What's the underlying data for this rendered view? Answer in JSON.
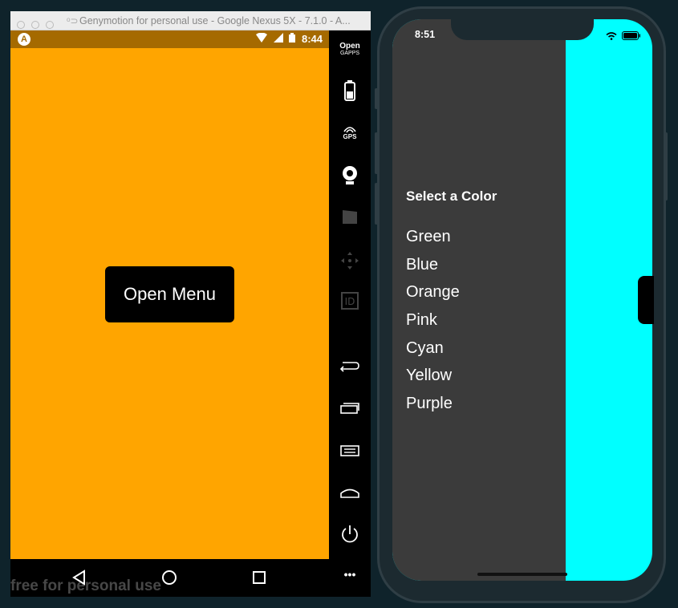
{
  "genymotion": {
    "window_title": "Genymotion for personal use - Google Nexus 5X - 7.1.0 - A...",
    "status_time": "8:44",
    "app_icon_letter": "A",
    "open_menu_label": "Open Menu",
    "watermark": "free for personal use",
    "sidebar": {
      "opengapps_line1": "Open",
      "opengapps_line2": "GAPPS",
      "gps_label": "GPS",
      "id_label": "ID",
      "more_label": "•••"
    }
  },
  "iphone": {
    "time": "8:51",
    "drawer_title": "Select a Color",
    "colors": [
      "Green",
      "Blue",
      "Orange",
      "Pink",
      "Cyan",
      "Yellow",
      "Purple"
    ]
  },
  "theme": {
    "app_background": "#ffa500",
    "drawer_background": "#3b3b3b",
    "content_background": "#00ffff",
    "status_bar": "#a56a00",
    "desktop_background": "#0f232b"
  },
  "icons": [
    "battery-icon",
    "gps-icon",
    "webcam-icon",
    "clapper-icon",
    "move-icon",
    "id-icon",
    "back-icon",
    "recents-icon",
    "menu-icon",
    "home-icon",
    "power-icon",
    "more-icon",
    "wifi-icon",
    "signal-icon"
  ]
}
